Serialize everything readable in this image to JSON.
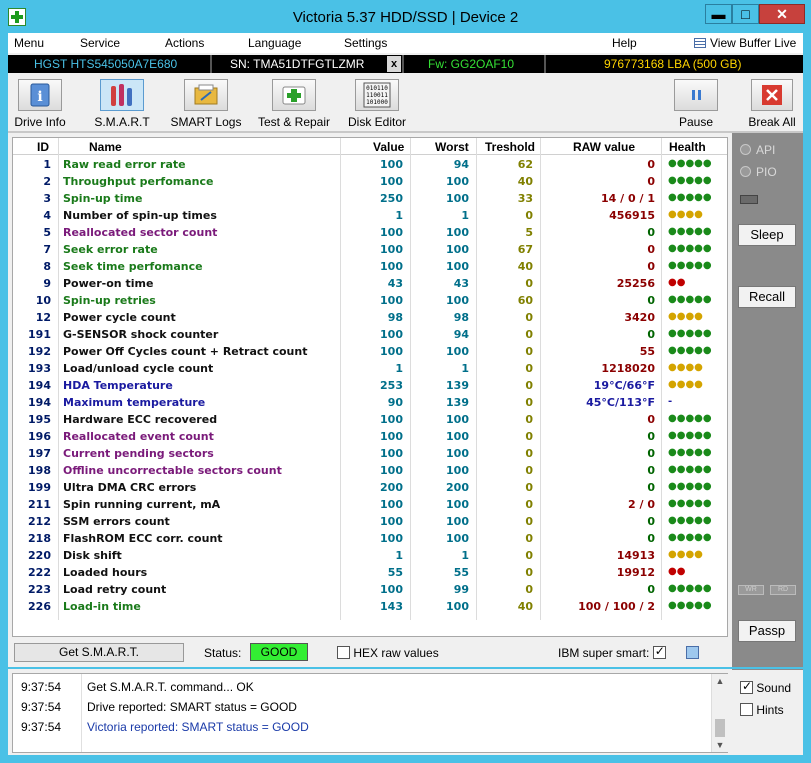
{
  "window": {
    "title": "Victoria 5.37 HDD/SSD | Device 2",
    "min": "▬",
    "max": "□",
    "close": "✕"
  },
  "menu": {
    "items": [
      "Menu",
      "Service",
      "Actions",
      "Language",
      "Settings",
      "Help"
    ],
    "view_buffer": "View Buffer Live"
  },
  "device": {
    "model": "HGST HTS545050A7E680",
    "serial": "SN: TMA51DTFGTLZMR",
    "close": "x",
    "firmware": "Fw: GG2OAF10",
    "capacity": "976773168 LBA (500 GB)"
  },
  "toolbar": {
    "drive_info": "Drive Info",
    "smart": "S.M.A.R.T",
    "smart_logs": "SMART Logs",
    "test_repair": "Test & Repair",
    "disk_editor": "Disk Editor",
    "pause": "Pause",
    "break_all": "Break All"
  },
  "table": {
    "headers": {
      "id": "ID",
      "name": "Name",
      "value": "Value",
      "worst": "Worst",
      "threshold": "Treshold",
      "raw": "RAW value",
      "health": "Health"
    },
    "rows": [
      {
        "id": "1",
        "name": "Raw read error rate",
        "value": "100",
        "worst": "94",
        "threshold": "62",
        "raw": "0",
        "health": "●●●●●",
        "name_color": "green",
        "raw_color": "red",
        "health_color": "green"
      },
      {
        "id": "2",
        "name": "Throughput perfomance",
        "value": "100",
        "worst": "100",
        "threshold": "40",
        "raw": "0",
        "health": "●●●●●",
        "name_color": "green",
        "raw_color": "red",
        "health_color": "green"
      },
      {
        "id": "3",
        "name": "Spin-up time",
        "value": "250",
        "worst": "100",
        "threshold": "33",
        "raw": "14 / 0 / 1",
        "health": "●●●●●",
        "name_color": "green",
        "raw_color": "red",
        "health_color": "green"
      },
      {
        "id": "4",
        "name": "Number of spin-up times",
        "value": "1",
        "worst": "1",
        "threshold": "0",
        "raw": "456915",
        "health": "●●●●",
        "name_color": "black",
        "raw_color": "red",
        "health_color": "yellow"
      },
      {
        "id": "5",
        "name": "Reallocated sector count",
        "value": "100",
        "worst": "100",
        "threshold": "5",
        "raw": "0",
        "health": "●●●●●",
        "name_color": "purple",
        "raw_color": "green",
        "health_color": "green"
      },
      {
        "id": "7",
        "name": "Seek error rate",
        "value": "100",
        "worst": "100",
        "threshold": "67",
        "raw": "0",
        "health": "●●●●●",
        "name_color": "green",
        "raw_color": "red",
        "health_color": "green"
      },
      {
        "id": "8",
        "name": "Seek time perfomance",
        "value": "100",
        "worst": "100",
        "threshold": "40",
        "raw": "0",
        "health": "●●●●●",
        "name_color": "green",
        "raw_color": "red",
        "health_color": "green"
      },
      {
        "id": "9",
        "name": "Power-on time",
        "value": "43",
        "worst": "43",
        "threshold": "0",
        "raw": "25256",
        "health": "●●",
        "name_color": "black",
        "raw_color": "red",
        "health_color": "red"
      },
      {
        "id": "10",
        "name": "Spin-up retries",
        "value": "100",
        "worst": "100",
        "threshold": "60",
        "raw": "0",
        "health": "●●●●●",
        "name_color": "green",
        "raw_color": "green",
        "health_color": "green"
      },
      {
        "id": "12",
        "name": "Power cycle count",
        "value": "98",
        "worst": "98",
        "threshold": "0",
        "raw": "3420",
        "health": "●●●●",
        "name_color": "black",
        "raw_color": "red",
        "health_color": "yellow"
      },
      {
        "id": "191",
        "name": "G-SENSOR shock counter",
        "value": "100",
        "worst": "94",
        "threshold": "0",
        "raw": "0",
        "health": "●●●●●",
        "name_color": "black",
        "raw_color": "green",
        "health_color": "green"
      },
      {
        "id": "192",
        "name": "Power Off Cycles count + Retract count",
        "value": "100",
        "worst": "100",
        "threshold": "0",
        "raw": "55",
        "health": "●●●●●",
        "name_color": "black",
        "raw_color": "red",
        "health_color": "green"
      },
      {
        "id": "193",
        "name": "Load/unload cycle count",
        "value": "1",
        "worst": "1",
        "threshold": "0",
        "raw": "1218020",
        "health": "●●●●",
        "name_color": "black",
        "raw_color": "red",
        "health_color": "yellow"
      },
      {
        "id": "194",
        "name": "HDA Temperature",
        "value": "253",
        "worst": "139",
        "threshold": "0",
        "raw": "19°C/66°F",
        "health": "●●●●",
        "name_color": "blue",
        "raw_color": "blue",
        "health_color": "yellow"
      },
      {
        "id": "194",
        "name": "Maximum temperature",
        "value": "90",
        "worst": "139",
        "threshold": "0",
        "raw": "45°C/113°F",
        "health": "-",
        "name_color": "blue",
        "raw_color": "blue",
        "health_color": "blue"
      },
      {
        "id": "195",
        "name": "Hardware ECC recovered",
        "value": "100",
        "worst": "100",
        "threshold": "0",
        "raw": "0",
        "health": "●●●●●",
        "name_color": "black",
        "raw_color": "red",
        "health_color": "green"
      },
      {
        "id": "196",
        "name": "Reallocated event count",
        "value": "100",
        "worst": "100",
        "threshold": "0",
        "raw": "0",
        "health": "●●●●●",
        "name_color": "purple",
        "raw_color": "green",
        "health_color": "green"
      },
      {
        "id": "197",
        "name": "Current pending sectors",
        "value": "100",
        "worst": "100",
        "threshold": "0",
        "raw": "0",
        "health": "●●●●●",
        "name_color": "purple",
        "raw_color": "green",
        "health_color": "green"
      },
      {
        "id": "198",
        "name": "Offline uncorrectable sectors count",
        "value": "100",
        "worst": "100",
        "threshold": "0",
        "raw": "0",
        "health": "●●●●●",
        "name_color": "purple",
        "raw_color": "green",
        "health_color": "green"
      },
      {
        "id": "199",
        "name": "Ultra DMA CRC errors",
        "value": "200",
        "worst": "200",
        "threshold": "0",
        "raw": "0",
        "health": "●●●●●",
        "name_color": "black",
        "raw_color": "green",
        "health_color": "green"
      },
      {
        "id": "211",
        "name": "Spin running current, mA",
        "value": "100",
        "worst": "100",
        "threshold": "0",
        "raw": "2 / 0",
        "health": "●●●●●",
        "name_color": "black",
        "raw_color": "red",
        "health_color": "green"
      },
      {
        "id": "212",
        "name": "SSM errors count",
        "value": "100",
        "worst": "100",
        "threshold": "0",
        "raw": "0",
        "health": "●●●●●",
        "name_color": "black",
        "raw_color": "green",
        "health_color": "green"
      },
      {
        "id": "218",
        "name": "FlashROM ECC corr. count",
        "value": "100",
        "worst": "100",
        "threshold": "0",
        "raw": "0",
        "health": "●●●●●",
        "name_color": "black",
        "raw_color": "green",
        "health_color": "green"
      },
      {
        "id": "220",
        "name": "Disk shift",
        "value": "1",
        "worst": "1",
        "threshold": "0",
        "raw": "14913",
        "health": "●●●●",
        "name_color": "black",
        "raw_color": "red",
        "health_color": "yellow"
      },
      {
        "id": "222",
        "name": "Loaded hours",
        "value": "55",
        "worst": "55",
        "threshold": "0",
        "raw": "19912",
        "health": "●●",
        "name_color": "black",
        "raw_color": "red",
        "health_color": "red"
      },
      {
        "id": "223",
        "name": "Load retry count",
        "value": "100",
        "worst": "99",
        "threshold": "0",
        "raw": "0",
        "health": "●●●●●",
        "name_color": "black",
        "raw_color": "green",
        "health_color": "green"
      },
      {
        "id": "226",
        "name": "Load-in time",
        "value": "143",
        "worst": "100",
        "threshold": "40",
        "raw": "100 / 100 / 2",
        "health": "●●●●●",
        "name_color": "green",
        "raw_color": "red",
        "health_color": "green"
      }
    ]
  },
  "side": {
    "api": "API",
    "pio": "PIO",
    "sleep": "Sleep",
    "recall": "Recall",
    "mini_a": "WR",
    "mini_b": "RD",
    "passp": "Passp"
  },
  "bottom": {
    "get_smart": "Get S.M.A.R.T.",
    "status_label": "Status:",
    "status_value": "GOOD",
    "hex_label": "HEX raw values",
    "ibm_label": "IBM super smart:"
  },
  "log": [
    {
      "time": "9:37:54",
      "message": "Get S.M.A.R.T. command... OK",
      "color": "#000000"
    },
    {
      "time": "9:37:54",
      "message": "Drive reported: SMART status = GOOD",
      "color": "#000000"
    },
    {
      "time": "9:37:54",
      "message": "Victoria reported: SMART status = GOOD",
      "color": "#1a3aa8"
    }
  ],
  "options": {
    "sound": "Sound",
    "hints": "Hints"
  }
}
